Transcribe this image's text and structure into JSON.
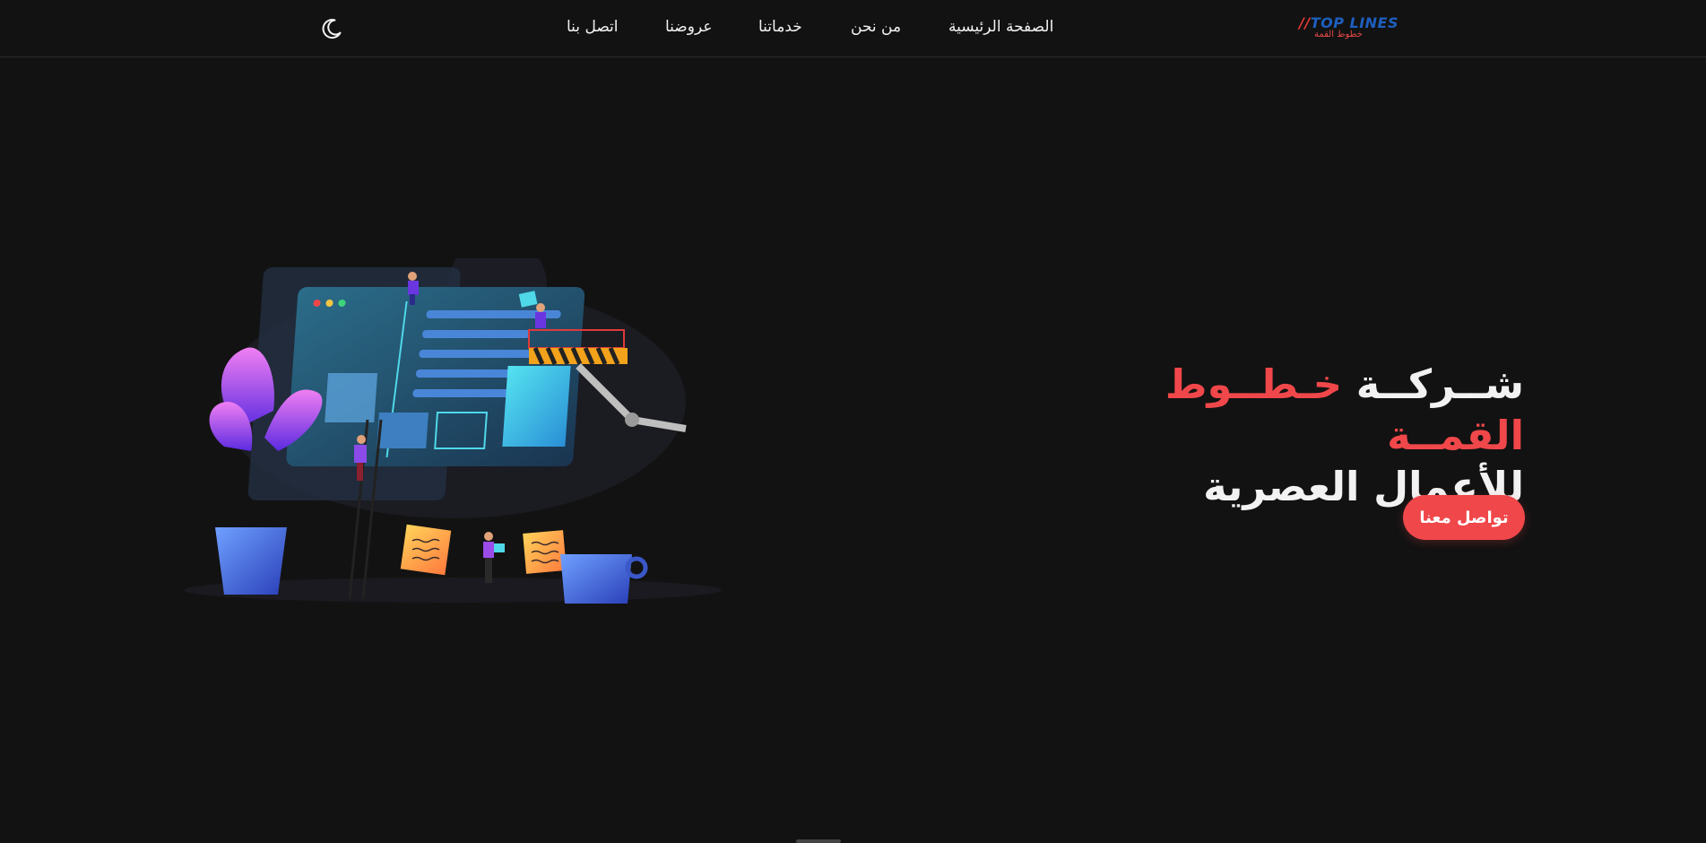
{
  "header": {
    "logo": {
      "main": "TOP LINES",
      "slashes": "//",
      "sub": "خطوط القمة"
    },
    "nav": [
      {
        "label": "الصفحة الرئيسية"
      },
      {
        "label": "من نحن"
      },
      {
        "label": "خدماتنا"
      },
      {
        "label": "عروضنا"
      },
      {
        "label": "اتصل بنا"
      }
    ],
    "theme_toggle_icon": "moon-icon"
  },
  "hero": {
    "title_word": "شــركــة",
    "title_accent": "خـطــوط القمــة",
    "title_line2": "للأعمال العصرية",
    "cta_label": "تواصل معنا",
    "illustration_icon": "website-construction-illustration"
  },
  "colors": {
    "background": "#121212",
    "accent": "#f0474a",
    "logo_blue": "#1e5fbf",
    "text": "#f2f2f2"
  }
}
